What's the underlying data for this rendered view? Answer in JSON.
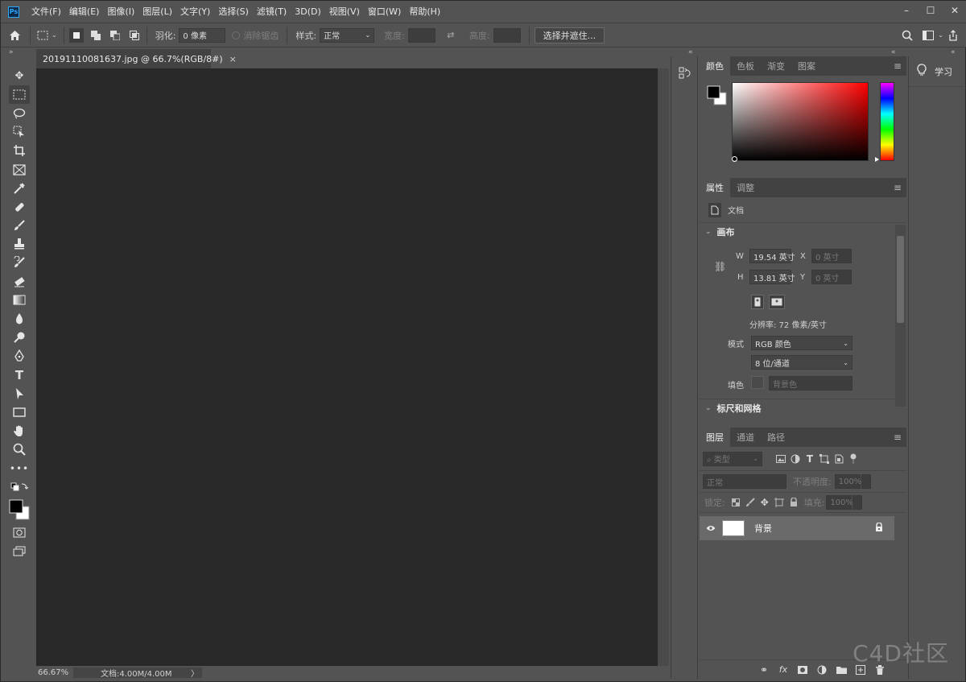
{
  "app": {
    "logo_text": "Ps"
  },
  "menu": [
    "文件(F)",
    "编辑(E)",
    "图像(I)",
    "图层(L)",
    "文字(Y)",
    "选择(S)",
    "滤镜(T)",
    "3D(D)",
    "视图(V)",
    "窗口(W)",
    "帮助(H)"
  ],
  "window_buttons": {
    "minimize": "–",
    "maximize": "☐",
    "close": "✕"
  },
  "options": {
    "feather_label": "羽化:",
    "feather_value": "0 像素",
    "antialias_label": "消除锯齿",
    "style_label": "样式:",
    "style_value": "正常",
    "width_label": "宽度:",
    "height_label": "高度:",
    "select_mask_button": "选择并遮住..."
  },
  "document": {
    "tab_title": "20191110081637.jpg @ 66.7%(RGB/8#)",
    "tab_close": "×",
    "zoom": "66.67%",
    "doc_info": "文档:4.00M/4.00M",
    "info_arrow": "〉"
  },
  "color_panel": {
    "tabs": [
      "颜色",
      "色板",
      "渐变",
      "图案"
    ],
    "active_tab": 0,
    "fg_color": "#000000",
    "bg_color": "#ffffff",
    "accent_hue": "#ff0000"
  },
  "properties_panel": {
    "tabs": [
      "属性",
      "调整"
    ],
    "active_tab": 0,
    "doc_label": "文档",
    "canvas_section": "画布",
    "w_label": "W",
    "w_value": "19.54 英寸",
    "h_label": "H",
    "h_value": "13.81 英寸",
    "x_label": "X",
    "x_value": "0 英寸",
    "y_label": "Y",
    "y_value": "0 英寸",
    "resolution": "分辨率: 72 像素/英寸",
    "mode_label": "模式",
    "mode_value": "RGB 颜色",
    "depth_value": "8 位/通道",
    "fill_label": "填色",
    "fill_value": "背景色",
    "next_section": "标尺和网格"
  },
  "layers_panel": {
    "tabs": [
      "图层",
      "通道",
      "路径"
    ],
    "active_tab": 0,
    "filter_label": "类型",
    "blend_mode": "正常",
    "opacity_label": "不透明度:",
    "opacity_value": "100%",
    "lock_label": "锁定:",
    "fill_label": "填充:",
    "fill_value": "100%",
    "layers": [
      {
        "name": "背景",
        "visible": true,
        "locked": true
      }
    ]
  },
  "learn_panel": {
    "label": "学习"
  },
  "watermark": "C4D社区"
}
